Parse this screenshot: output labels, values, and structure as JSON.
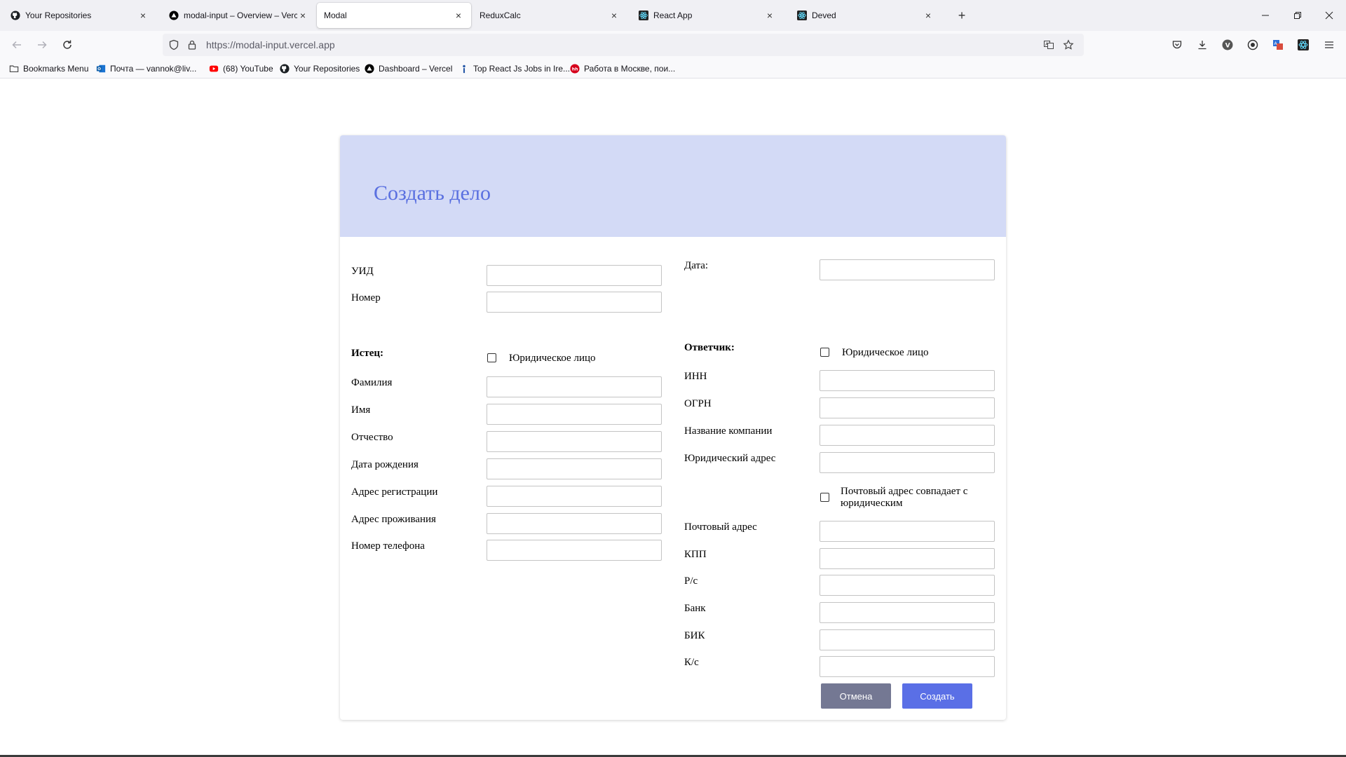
{
  "browser": {
    "tabs": [
      {
        "title": "Your Repositories",
        "icon": "github-icon"
      },
      {
        "title": "modal-input – Overview – Verce",
        "icon": "vercel-icon"
      },
      {
        "title": "Modal",
        "icon": "",
        "active": true
      },
      {
        "title": "ReduxCalc",
        "icon": ""
      },
      {
        "title": "React App",
        "icon": "react-icon"
      },
      {
        "title": "Deved",
        "icon": "react-icon"
      }
    ],
    "url": "https://modal-input.vercel.app",
    "bookmarks": [
      {
        "label": "Bookmarks Menu",
        "icon": "folder-icon"
      },
      {
        "label": "Почта — vannok@liv...",
        "icon": "outlook-icon"
      },
      {
        "label": "(68) YouTube",
        "icon": "youtube-icon"
      },
      {
        "label": "Your Repositories",
        "icon": "github-icon"
      },
      {
        "label": "Dashboard – Vercel",
        "icon": "vercel-icon"
      },
      {
        "label": "Top React Js Jobs in Ire...",
        "icon": "indeed-icon"
      },
      {
        "label": "Работа в Москве, пои...",
        "icon": "hh-icon"
      }
    ]
  },
  "form": {
    "title": "Создать дело",
    "uid_label": "УИД",
    "number_label": "Номер",
    "date_label": "Дата:",
    "plaintiff": {
      "heading": "Истец:",
      "legal_entity_label": "Юридическое лицо",
      "fields": [
        "Фамилия",
        "Имя",
        "Отчество",
        "Дата рождения",
        "Адрес регистрации",
        "Адрес проживания",
        "Номер телефона"
      ]
    },
    "defendant": {
      "heading": "Ответчик:",
      "legal_entity_label": "Юридическое лицо",
      "fields_top": [
        "ИНН",
        "ОГРН",
        "Название компании",
        "Юридический адрес"
      ],
      "postal_same_label": "Почтовый адрес совпадает с юридическим",
      "fields_bottom": [
        "Почтовый адрес",
        "КПП",
        "Р/с",
        "Банк",
        "БИК",
        "К/с"
      ]
    },
    "cancel_label": "Отмена",
    "create_label": "Создать"
  }
}
